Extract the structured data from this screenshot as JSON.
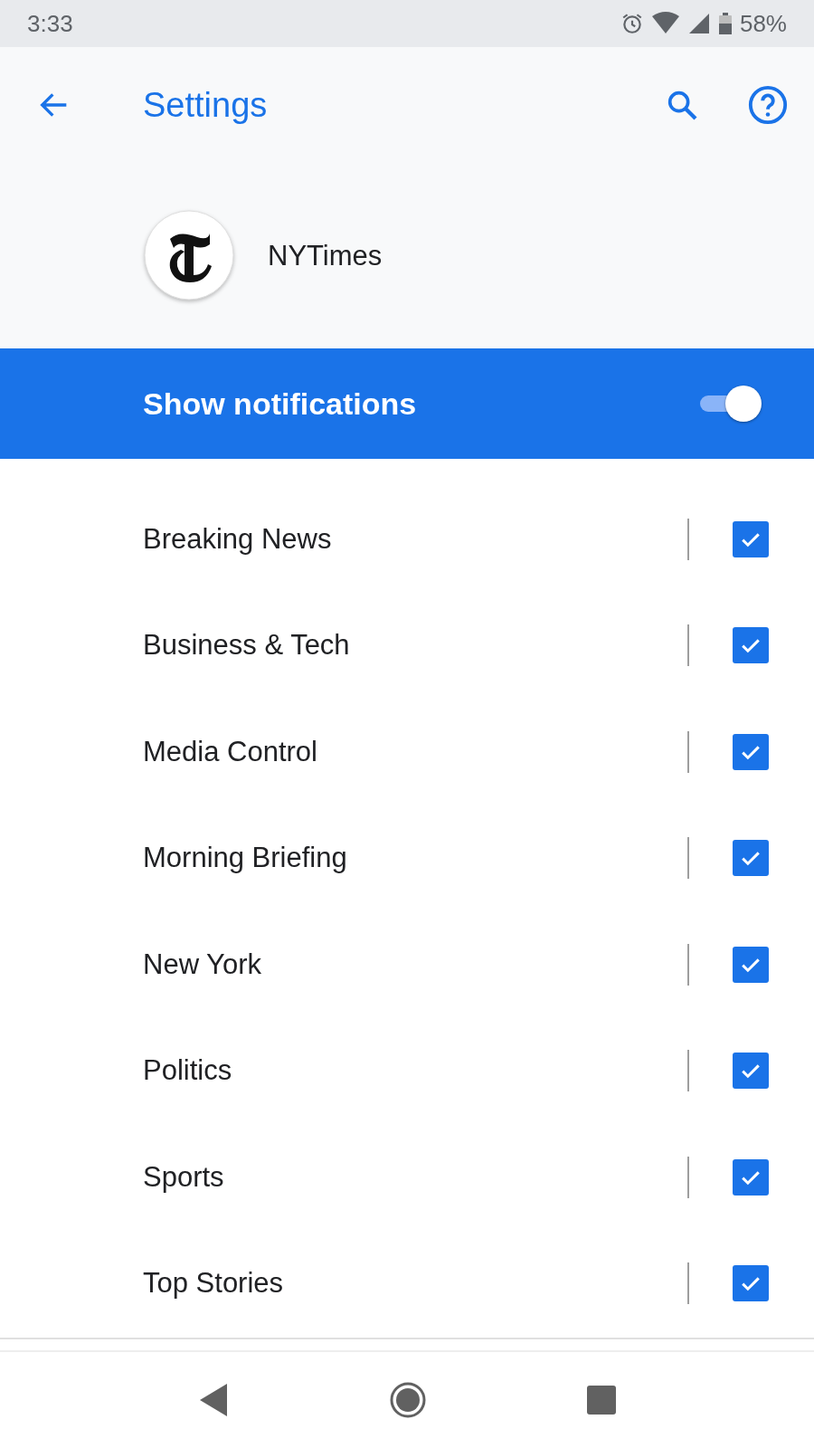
{
  "status_bar": {
    "time": "3:33",
    "battery": "58%"
  },
  "app_bar": {
    "title": "Settings"
  },
  "app": {
    "name": "NYTimes"
  },
  "master_switch": {
    "label": "Show notifications",
    "on": true
  },
  "channels": [
    {
      "name": "Breaking News",
      "checked": true
    },
    {
      "name": "Business & Tech",
      "checked": true
    },
    {
      "name": "Media Control",
      "checked": true
    },
    {
      "name": "Morning Briefing",
      "checked": true
    },
    {
      "name": "New York",
      "checked": true
    },
    {
      "name": "Politics",
      "checked": true
    },
    {
      "name": "Sports",
      "checked": true
    },
    {
      "name": "Top Stories",
      "checked": true
    }
  ]
}
